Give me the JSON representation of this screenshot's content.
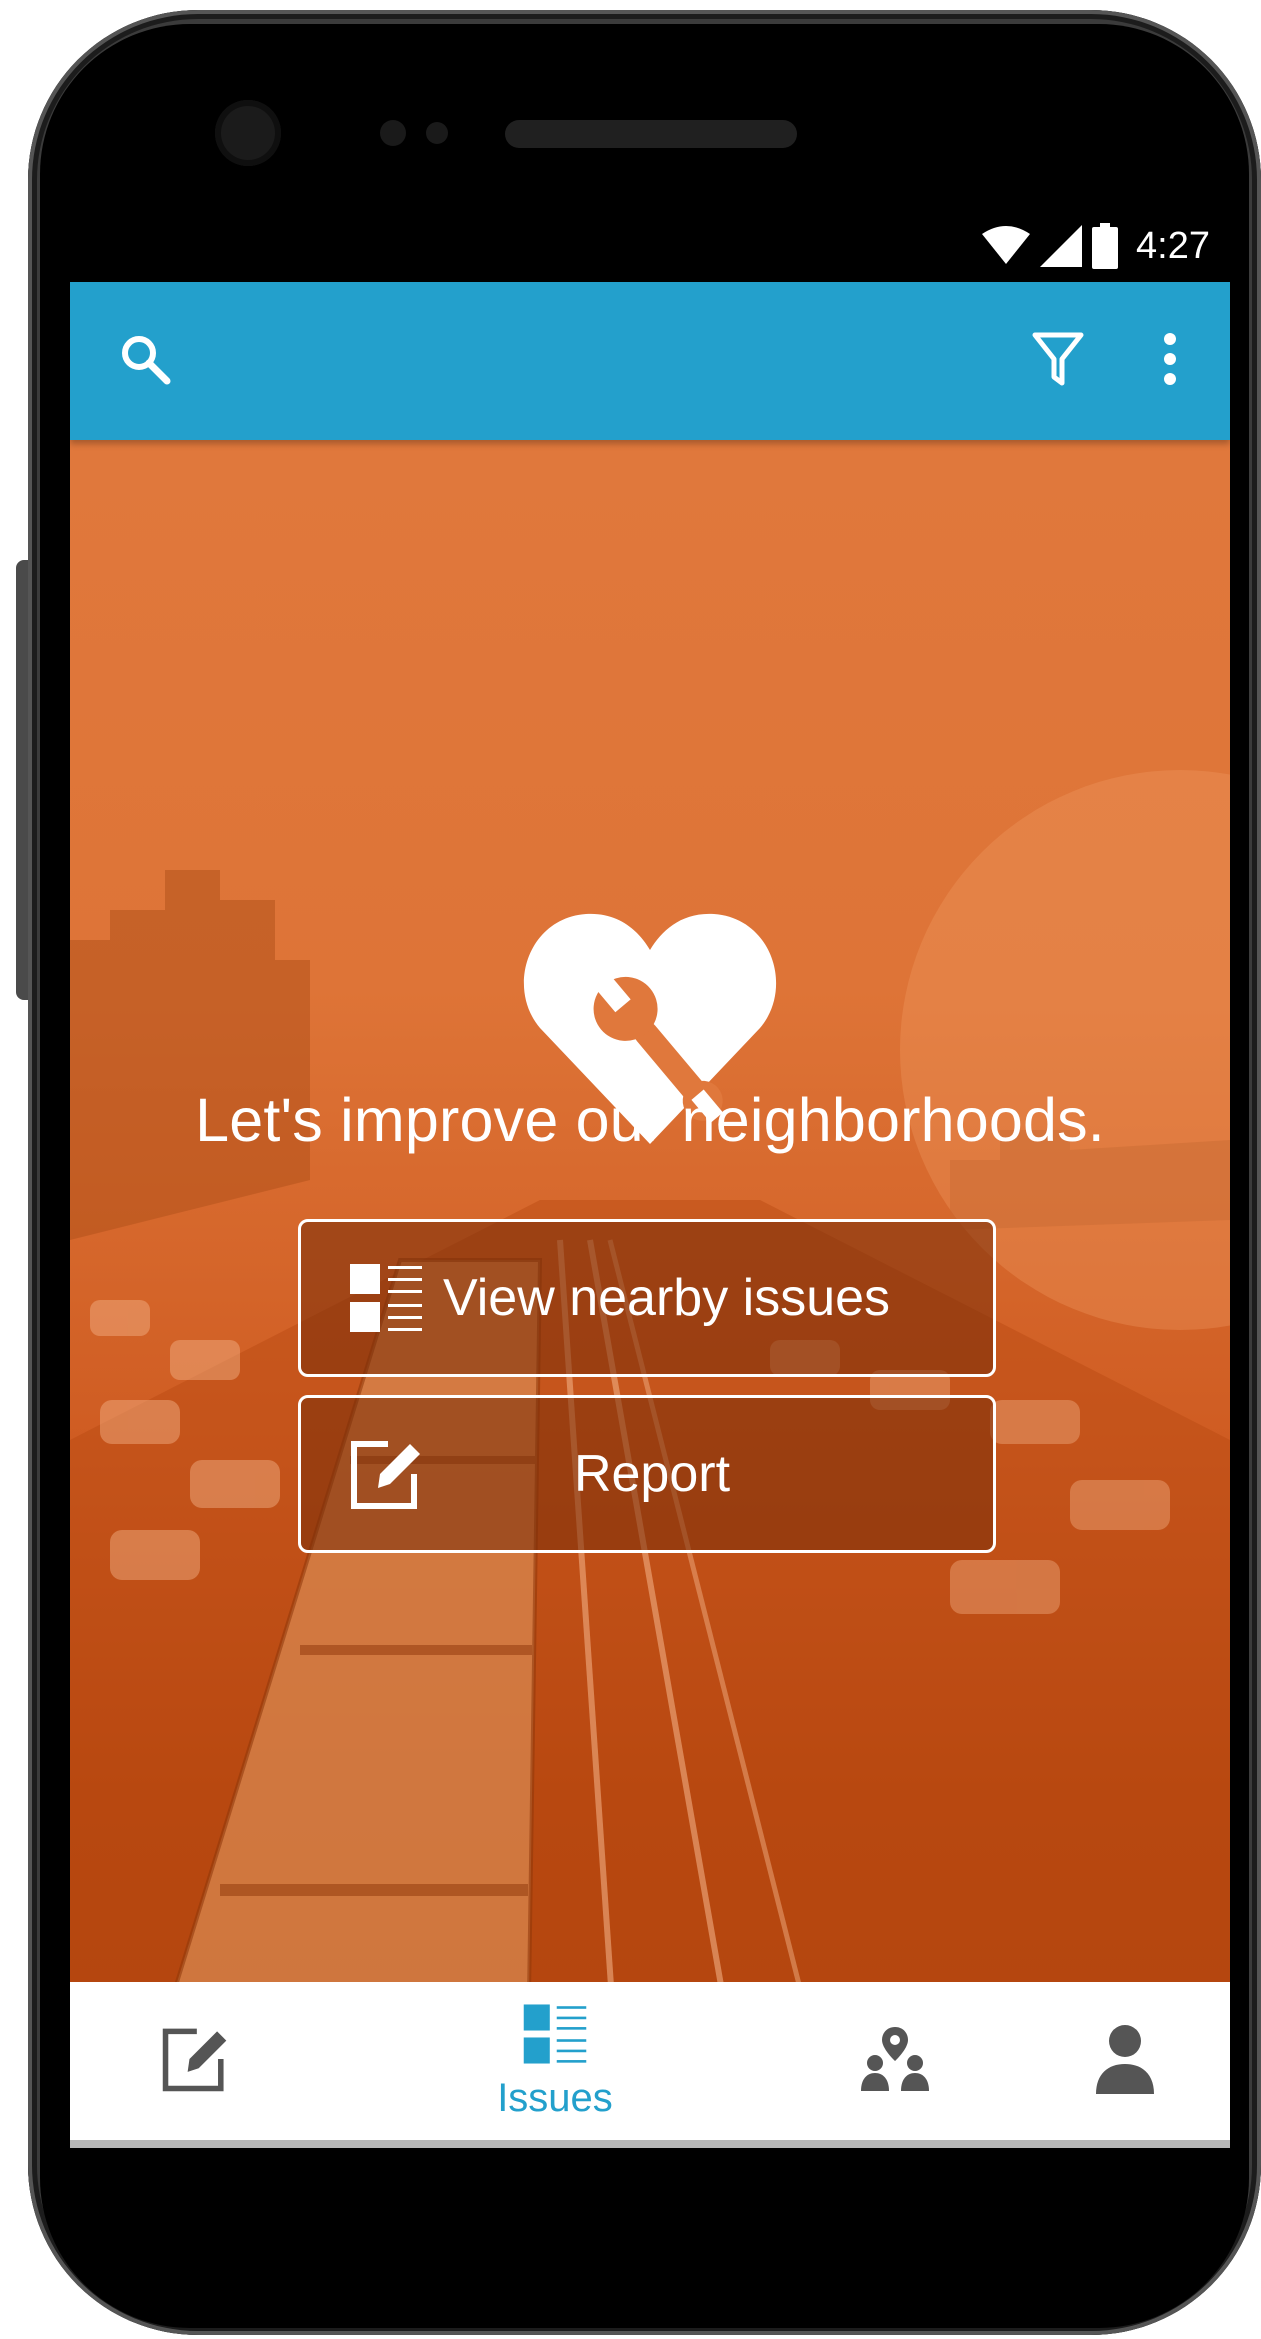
{
  "status_bar": {
    "time": "4:27",
    "icons": [
      "wifi-icon",
      "signal-icon",
      "battery-icon"
    ]
  },
  "app_bar": {
    "icons": [
      "search-icon",
      "filter-icon",
      "more-vert-icon"
    ],
    "color": "#23a0cc"
  },
  "hero": {
    "logo_icon": "heart-wrench-icon",
    "tagline": "Let's improve our neighborhoods.",
    "buttons": [
      {
        "label": "View nearby issues",
        "icon": "list-icon"
      },
      {
        "label": "Report",
        "icon": "edit-icon"
      }
    ],
    "overlay_color": "#e0783c"
  },
  "bottom_nav": {
    "items": [
      {
        "icon": "edit-icon",
        "label": "",
        "active": false
      },
      {
        "icon": "list-icon",
        "label": "Issues",
        "active": true
      },
      {
        "icon": "community-icon",
        "label": "",
        "active": false
      },
      {
        "icon": "person-icon",
        "label": "",
        "active": false
      }
    ],
    "active_color": "#23a0cc",
    "inactive_color": "#555555"
  }
}
